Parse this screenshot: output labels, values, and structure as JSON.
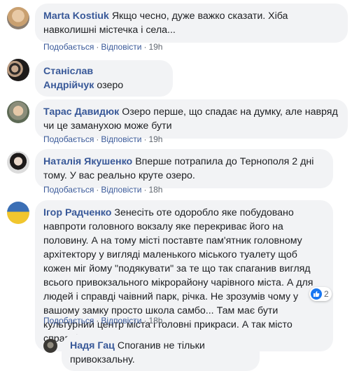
{
  "labels": {
    "like": "Подобається",
    "reply": "Відповісти",
    "sep": "·"
  },
  "comments": [
    {
      "author": "Marta Kostiuk",
      "text": "Якщо чесно, дуже важко сказати. Хіба навколишні містечка і села...",
      "time": "19h"
    },
    {
      "author": "Станіслав Андрійчук",
      "text": "озеро"
    },
    {
      "author": "Тарас Давидюк",
      "text": "Озеро перше, що спадає на думку, але навряд чи це заманухою може бути",
      "time": "19h"
    },
    {
      "author": "Наталія Якушенко",
      "text": "Вперше потрапила до Тернополя 2 дні тому. У вас реально круте озеро.",
      "time": "18h"
    },
    {
      "author": "Ігор Радченко",
      "text": "Зенесіть оте одоробло яке побудовано навпроти головного вокзалу яке перекриває його на половину. А на тому місті поставте пам'ятник головному архітектору у вигляді маленького міського туалету щоб кожен міг йому \"подякувати\" за те що так спаганив вигляд всього привокзального мікрорайону чарівного міста. А для людей і справді чаівний парк, річка. Не зрозумів чому у вашому замку просто школа самбо... Там має бути культурний центр міста і головні прикраси. А так місто справді має сво душу.",
      "time": "18h",
      "reactions": "2"
    },
    {
      "author": "Надя Гац",
      "text": "Споганив не тільки привокзальну."
    }
  ],
  "colors": {
    "bubble": "#f2f3f5",
    "author": "#385898",
    "meta": "#606770",
    "like": "#1877f2"
  },
  "icons": {
    "like_reaction": "thumbs-up-icon"
  }
}
